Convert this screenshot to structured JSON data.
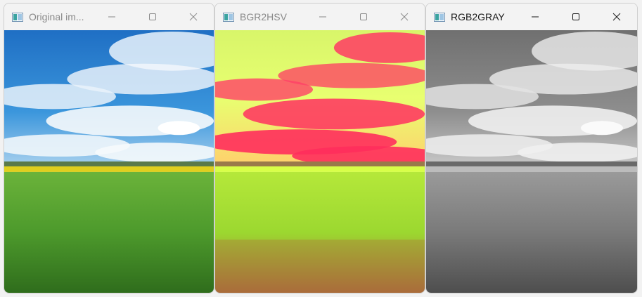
{
  "windows": [
    {
      "title": "Original im...",
      "state": "inactive",
      "image": {
        "variant": "original",
        "sky": "#2a86d8",
        "cloud": "#f4f8fc",
        "horizon_band": "#e6d21c",
        "field": "#4a9a2c"
      }
    },
    {
      "title": "BGR2HSV",
      "state": "inactive",
      "image": {
        "variant": "hsv",
        "sky": "#e8ff70",
        "cloud": "#ff3060",
        "horizon_band": "#ffd070",
        "field": "#9cd830"
      }
    },
    {
      "title": "RGB2GRAY",
      "state": "active",
      "image": {
        "variant": "gray",
        "sky": "#8a8a8a",
        "cloud": "#efefef",
        "horizon_band": "#bcbcbc",
        "field": "#7a7a7a"
      }
    }
  ],
  "icons": {
    "app": "image-window-icon",
    "minimize": "minimize-icon",
    "maximize": "maximize-icon",
    "close": "close-icon"
  }
}
